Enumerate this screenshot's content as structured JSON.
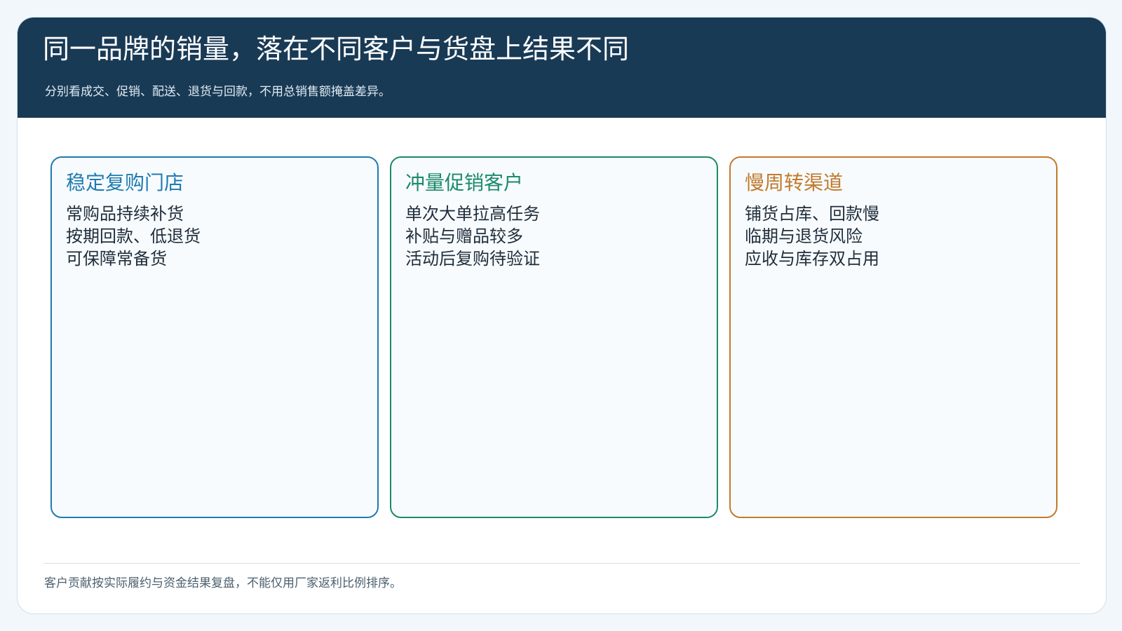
{
  "header": {
    "title": "同一品牌的销量，落在不同客户与货盘上结果不同",
    "subtitle": "分别看成交、促销、配送、退货与回款，不用总销售额掩盖差异。"
  },
  "cards": [
    {
      "title": "稳定复购门店",
      "lines": [
        "常购品持续补货",
        "按期回款、低退货",
        "可保障常备货"
      ],
      "color": "#1f7bb0"
    },
    {
      "title": "冲量促销客户",
      "lines": [
        "单次大单拉高任务",
        "补贴与赠品较多",
        "活动后复购待验证"
      ],
      "color": "#1b8a6b"
    },
    {
      "title": "慢周转渠道",
      "lines": [
        "铺货占库、回款慢",
        "临期与退货风险",
        "应收与库存双占用"
      ],
      "color": "#c27a2c"
    }
  ],
  "footer": {
    "note": "客户贡献按实际履约与资金结果复盘，不能仅用厂家返利比例排序。"
  }
}
